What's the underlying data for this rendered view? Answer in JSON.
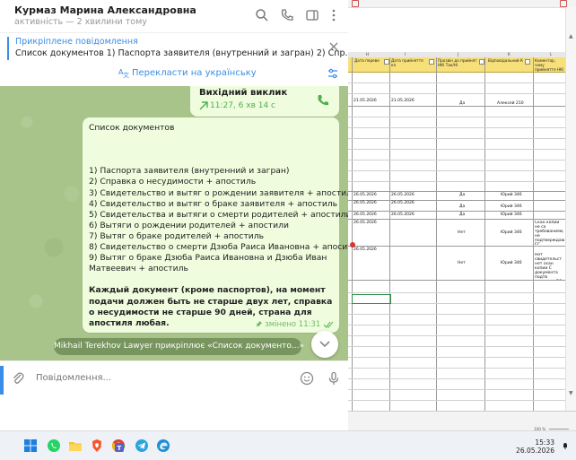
{
  "telegram": {
    "contact_name": "Курмаз Марина Александровна",
    "status": "активність — 2 хвилини тому",
    "pinned": {
      "title": "Прикріплене повідомлення",
      "text": "Список документов    1) Паспорта заявителя (внутренний и загран) 2) Спр..."
    },
    "translate_label": "Перекласти на українську",
    "call": {
      "title": "Вихідний виклик",
      "meta": "11:27, 6 хв 14 с"
    },
    "message": {
      "heading": "Список документов",
      "items": [
        "1) Паспорта заявителя (внутренний и загран)",
        "2) Справка о несудимости + апостиль",
        "3) Свидетельство и вытяг о рождении заявителя + апостили",
        "4) Свидетельство и вытяг о браке заявителя + апостиль",
        "5) Свидетельства и вытяги о смерти родителей + апостили",
        "6) Вытяги о рождении родителей + апостили",
        "7) Вытяг о браке родителей + апостиль",
        "8) Свидетельство о смерти Дзюба Раиса  Ивановна + апоситль",
        "9) Вытяг о браке Дзюба Раиса  Ивановна и Дзюба Иван",
        "Матвеевич + апостиль"
      ],
      "note": "Каждый документ (кроме паспортов), на момент подачи должен быть не старше двух лет, справка о несудимости не старше 90 дней, страна для апостиля любая.",
      "meta": "змінено 11:31"
    },
    "service_message": "Mikhail Terekhov Lawyer прикріплює «Список документо...»",
    "compose_placeholder": "Повідомлення..."
  },
  "spreadsheet": {
    "column_letters": [
      "H",
      "I",
      "J",
      "K",
      "L"
    ],
    "headers": [
      "Дата переве",
      "Дата прийняття кл",
      "Прозвін до прийнят НКІ Так/Ні",
      "Відповідальний К",
      "Коментар, чому прийняття НКІ"
    ],
    "rows": [
      {
        "h": "21.05.2026",
        "i": "21.05.2026",
        "j": "Да",
        "k": "Алексей 210",
        "l": ""
      },
      {
        "h": "26.05.2026",
        "i": "26.05.2026",
        "j": "Да",
        "k": "Юрий 346",
        "l": ""
      },
      {
        "h": "26.05.2026",
        "i": "26.05.2026",
        "j": "Да",
        "k": "Юрий 346",
        "l": ""
      },
      {
        "h": "26.05.2026",
        "i": "26.05.2026",
        "j": "Да",
        "k": "Юрий 346",
        "l": ""
      },
      {
        "h": "26.05.2026",
        "i": "",
        "j": "Нет",
        "k": "Юрий 346",
        "l": "Скан копии не со требованиям, не подтверждающие ЕС"
      },
      {
        "h": "26.05.2026",
        "i": "",
        "j": "Нет",
        "k": "Юрий 346",
        "l": "Нет свидетельст нет скан копии С документа подтв защиты в ЕС"
      }
    ],
    "zoom": "100 %"
  },
  "taskbar": {
    "time": "15:33",
    "date": "26.05.2026",
    "icons": [
      "windows-start-icon",
      "whatsapp-icon",
      "file-explorer-icon",
      "brave-icon",
      "chrome-icon",
      "teams-icon",
      "telegram-icon",
      "edge-icon"
    ]
  }
}
